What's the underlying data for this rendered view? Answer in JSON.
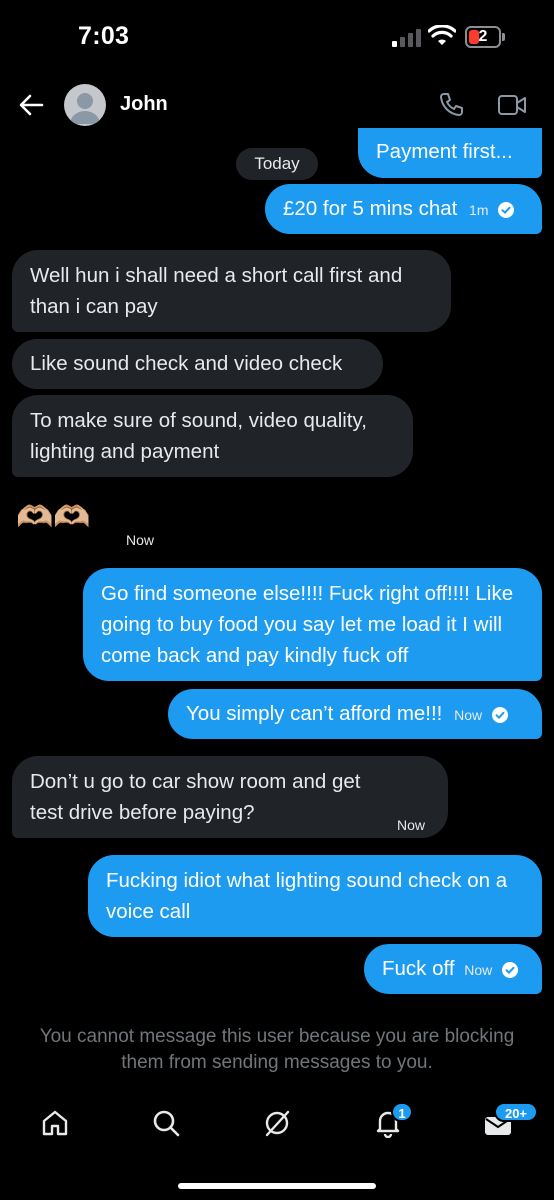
{
  "status_bar": {
    "time": "7:03",
    "battery": "2"
  },
  "header": {
    "contact_name": "John"
  },
  "day_separator": "Today",
  "messages": [
    {
      "dir": "sent",
      "text": "Payment first..."
    },
    {
      "dir": "sent",
      "text": "£20 for 5 mins chat",
      "time": "1m"
    },
    {
      "dir": "received",
      "text": "Well hun i shall need a short call first and than i can pay"
    },
    {
      "dir": "received",
      "text": "Like sound check and video check"
    },
    {
      "dir": "received",
      "text": "To make sure of sound, video quality, lighting and payment"
    },
    {
      "dir": "received",
      "text": "🫶🏼🫶🏼",
      "time": "Now"
    },
    {
      "dir": "sent",
      "text": "Go find someone else!!!! Fuck right off!!!! Like going to buy food you say let me load it I will come back and pay kindly fuck off"
    },
    {
      "dir": "sent",
      "text": "You simply can’t afford me!!!",
      "time": "Now"
    },
    {
      "dir": "received",
      "text": "Don’t u go to car show room and get test drive before paying?",
      "time": "Now"
    },
    {
      "dir": "sent",
      "text": "Fucking idiot what lighting sound check on a voice call"
    },
    {
      "dir": "sent",
      "text": "Fuck off",
      "time": "Now"
    }
  ],
  "blocked_note": "You cannot message this user because you are blocking them from sending messages to you.",
  "nav": {
    "items": [
      "home-icon",
      "search-icon",
      "grok-icon",
      "notifications-icon",
      "messages-icon"
    ],
    "notifications_badge": "1",
    "messages_badge": "20+"
  },
  "colors": {
    "accent": "#1d9bf0",
    "received_bubble": "#202327",
    "muted_text": "#71767b"
  }
}
